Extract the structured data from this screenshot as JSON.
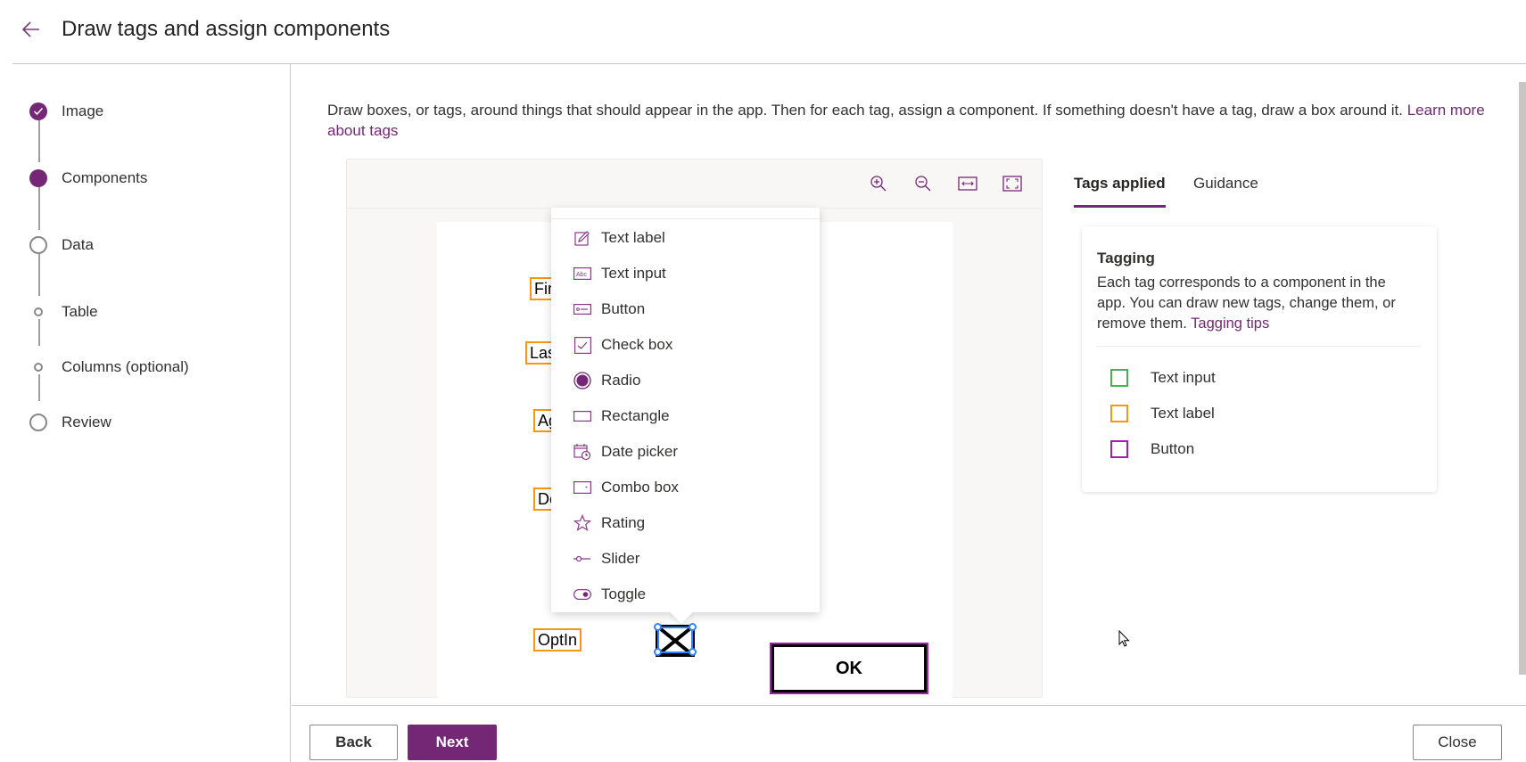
{
  "header": {
    "title": "Draw tags and assign components",
    "back_icon": "arrow-left-icon"
  },
  "steps": [
    {
      "label": "Image",
      "state": "completed"
    },
    {
      "label": "Components",
      "state": "current"
    },
    {
      "label": "Data",
      "state": "pending"
    },
    {
      "label": "Table",
      "state": "sub-pending"
    },
    {
      "label": "Columns (optional)",
      "state": "sub-pending"
    },
    {
      "label": "Review",
      "state": "pending"
    }
  ],
  "intro": {
    "text": "Draw boxes, or tags, around things that should appear in the app. Then for each tag, assign a component. If something doesn't have a tag, draw a box around it.",
    "link": "Learn more about tags"
  },
  "canvas_toolbar": {
    "zoom_in": "zoom-in-icon",
    "zoom_out": "zoom-out-icon",
    "fit_width": "fit-width-icon",
    "fit_page": "fit-page-icon"
  },
  "image_tags": {
    "labels": [
      "Fir",
      "Las",
      "Ag",
      "De",
      "OptIn"
    ],
    "button_text": "OK"
  },
  "component_menu": {
    "items": [
      {
        "label": "Text label",
        "icon": "text-label-icon"
      },
      {
        "label": "Text input",
        "icon": "text-input-icon"
      },
      {
        "label": "Button",
        "icon": "button-icon"
      },
      {
        "label": "Check box",
        "icon": "checkbox-icon"
      },
      {
        "label": "Radio",
        "icon": "radio-icon"
      },
      {
        "label": "Rectangle",
        "icon": "rectangle-icon"
      },
      {
        "label": "Date picker",
        "icon": "date-picker-icon"
      },
      {
        "label": "Combo box",
        "icon": "combo-box-icon"
      },
      {
        "label": "Rating",
        "icon": "star-icon"
      },
      {
        "label": "Slider",
        "icon": "slider-icon"
      },
      {
        "label": "Toggle",
        "icon": "toggle-icon"
      }
    ]
  },
  "right_panel": {
    "tabs": [
      {
        "label": "Tags applied",
        "active": true
      },
      {
        "label": "Guidance",
        "active": false
      }
    ],
    "card": {
      "title": "Tagging",
      "text": "Each tag corresponds to a component in the app. You can draw new tags, change them, or remove them.",
      "link": "Tagging tips"
    },
    "legend": [
      {
        "label": "Text input",
        "color": "#4caf50"
      },
      {
        "label": "Text label",
        "color": "#f7960f"
      },
      {
        "label": "Button",
        "color": "#a21fae"
      }
    ]
  },
  "footer": {
    "back": "Back",
    "next": "Next",
    "close": "Close"
  },
  "colors": {
    "accent": "#742774",
    "text_input_tag": "#4caf50",
    "text_label_tag": "#f7960f",
    "button_tag": "#a21fae",
    "selection": "#2e86ff"
  }
}
